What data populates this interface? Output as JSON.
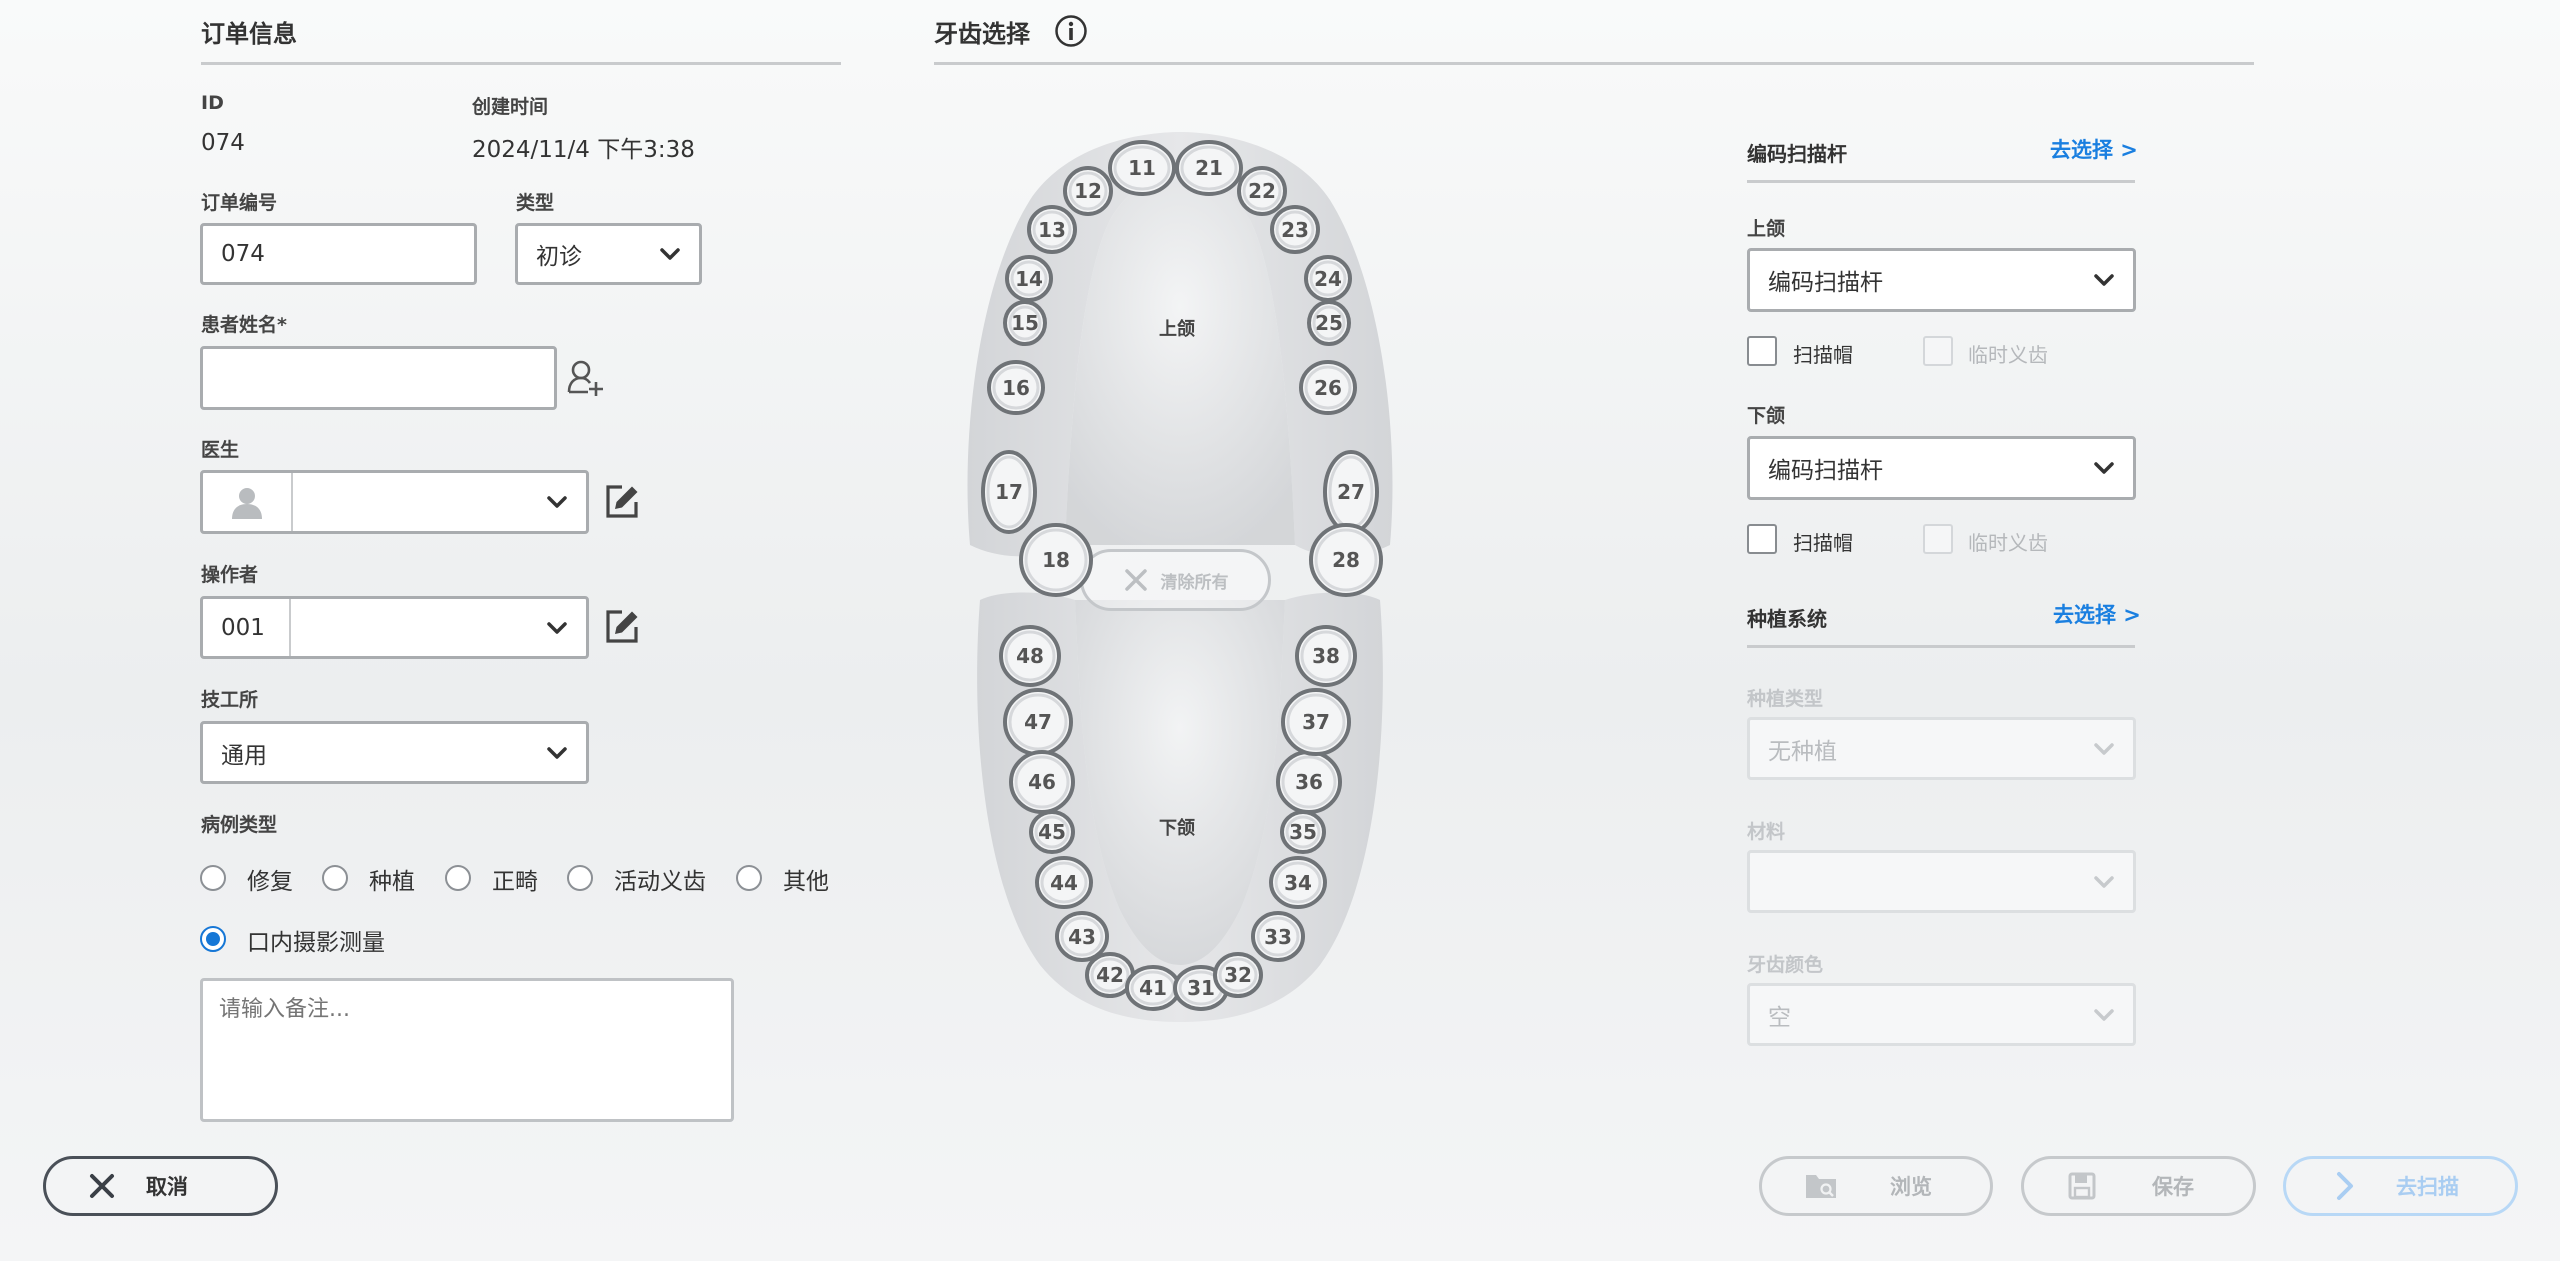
{
  "order_info": {
    "title": "订单信息",
    "id_label": "ID",
    "id_value": "074",
    "created_label": "创建时间",
    "created_value": "2024/11/4 下午3:38",
    "order_no_label": "订单编号",
    "order_no_value": "074",
    "type_label": "类型",
    "type_value": "初诊",
    "patient_label": "患者姓名*",
    "patient_value": "",
    "doctor_label": "医生",
    "doctor_value": "",
    "operator_label": "操作者",
    "operator_value": "001",
    "lab_label": "技工所",
    "lab_value": "通用",
    "case_type_label": "病例类型",
    "case_types": [
      "修复",
      "种植",
      "正畸",
      "活动义齿",
      "其他",
      "口内摄影测量"
    ],
    "case_type_selected": "口内摄影测量",
    "notes_placeholder": "请输入备注..."
  },
  "teeth": {
    "title": "牙齿选择",
    "upper_label": "上颌",
    "lower_label": "下颌",
    "clear_all": "清除所有",
    "upper_teeth": [
      "18",
      "17",
      "16",
      "15",
      "14",
      "13",
      "12",
      "11",
      "21",
      "22",
      "23",
      "24",
      "25",
      "26",
      "27",
      "28"
    ],
    "lower_teeth": [
      "48",
      "47",
      "46",
      "45",
      "44",
      "43",
      "42",
      "41",
      "31",
      "32",
      "33",
      "34",
      "35",
      "36",
      "37",
      "38"
    ]
  },
  "scan_body": {
    "title": "编码扫描杆",
    "select_link": "去选择 >",
    "upper_label": "上颌",
    "upper_value": "编码扫描杆",
    "upper_check1": "扫描帽",
    "upper_check2": "临时义齿",
    "lower_label": "下颌",
    "lower_value": "编码扫描杆",
    "lower_check1": "扫描帽",
    "lower_check2": "临时义齿"
  },
  "implant": {
    "title": "种植系统",
    "select_link": "去选择 >",
    "type_label": "种植类型",
    "type_value": "无种植",
    "material_label": "材料",
    "material_value": "",
    "color_label": "牙齿颜色",
    "color_value": "空"
  },
  "footer": {
    "cancel": "取消",
    "browse": "浏览",
    "save": "保存",
    "scan": "去扫描"
  }
}
